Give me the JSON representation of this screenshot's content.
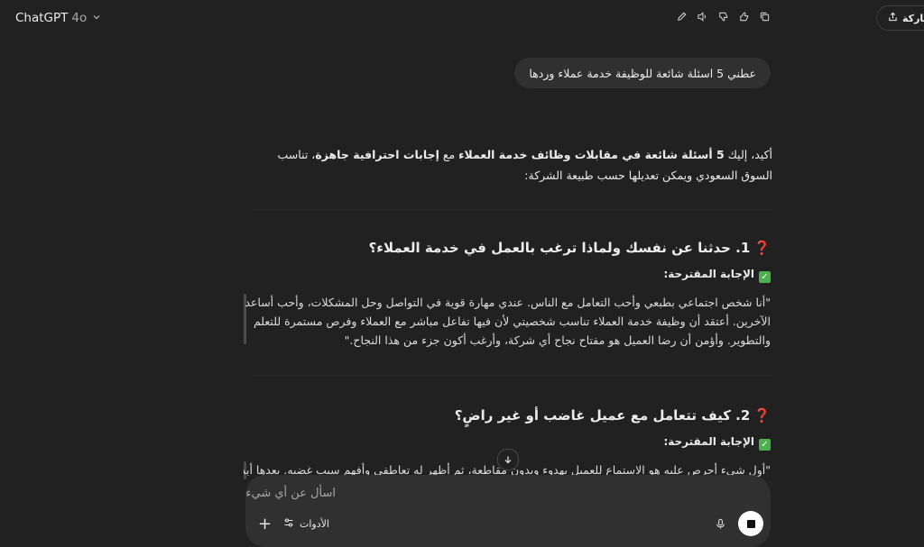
{
  "header": {
    "model_name": "ChatGPT",
    "model_version": "4o",
    "share_label": "مشاركة"
  },
  "user_message": "عطني 5 اسئلة شائعة للوظيفة خدمة عملاء وردها",
  "reply": {
    "intro_pre": "أكيد، إليك ",
    "intro_bold1": "5 أسئلة شائعة في مقابلات وظائف خدمة العملاء",
    "intro_mid": " مع ",
    "intro_bold2": "إجابات احترافية جاهزة",
    "intro_post": "، تناسب السوق السعودي ويمكن تعديلها حسب طبيعة الشركة:",
    "questions": [
      {
        "qmark": "❓",
        "title": "1. حدثنا عن نفسك ولماذا ترغب بالعمل في خدمة العملاء؟",
        "answer_label": "الإجابة المقترحة:",
        "answer": "\"أنا شخص اجتماعي بطبعي وأحب التعامل مع الناس. عندي مهارة قوية في التواصل وحل المشكلات، وأحب أساعد الآخرين. أعتقد أن وظيفة خدمة العملاء تناسب شخصيتي لأن فيها تفاعل مباشر مع العملاء وفرص مستمرة للتعلم والتطوير. وأؤمن أن رضا العميل هو مفتاح نجاح أي شركة، وأرغب أكون جزء من هذا النجاح.\""
      },
      {
        "qmark": "❓",
        "title": "2. كيف تتعامل مع عميل غاضب أو غير راضٍ؟",
        "answer_label": "الإجابة المقترحة:",
        "answer": "\"أول شيء أحرص عليه هو الاستماع للعميل بهدوء وبدون مقاطعة، ثم أظهر له تعاطفي وأفهم سبب غضبه. بعدها أبدأ"
      }
    ]
  },
  "composer": {
    "placeholder": "اسأل عن أي شيء",
    "tools_label": "الأدوات"
  }
}
